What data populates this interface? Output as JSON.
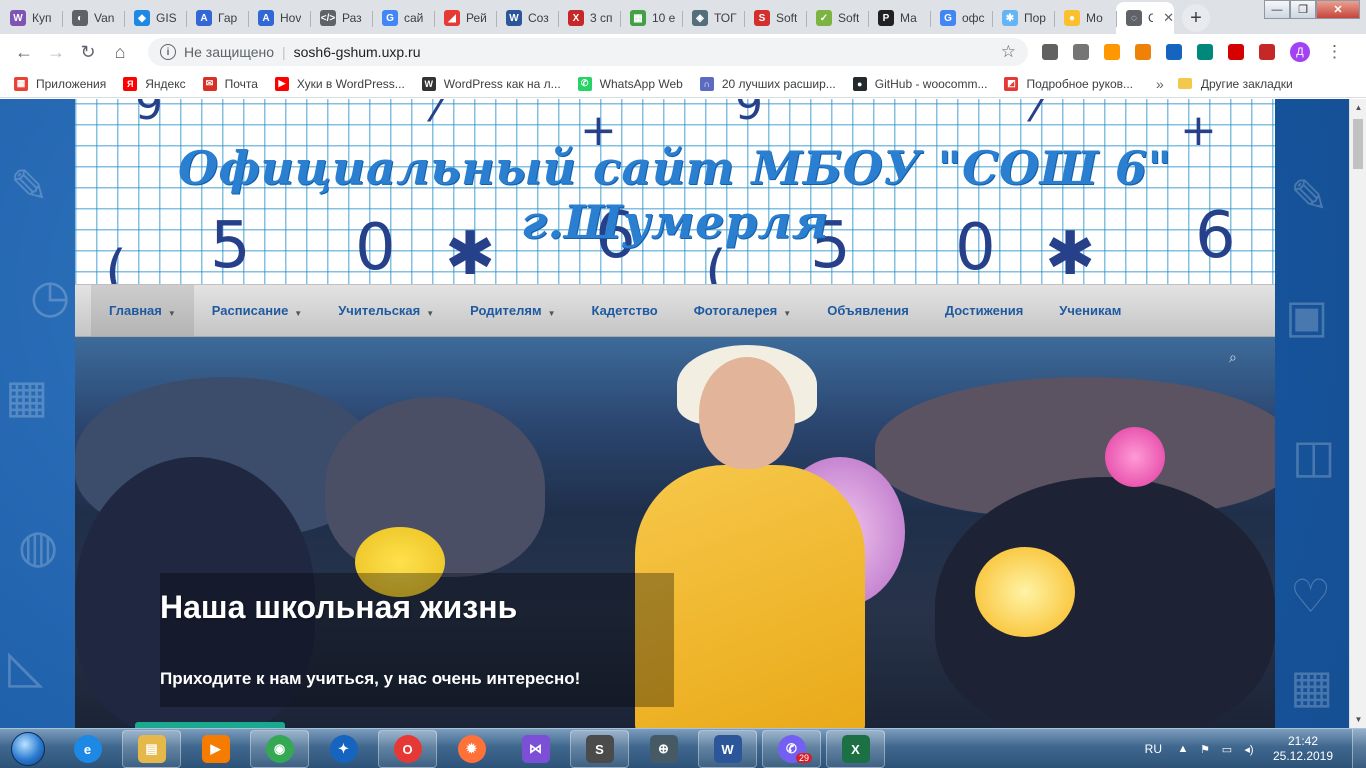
{
  "tabs": [
    {
      "title": "Куп",
      "icon": "woocommerce-icon",
      "color": "#7f54b3",
      "glyph": "W"
    },
    {
      "title": "Van",
      "icon": "globe-icon",
      "color": "#5f6368",
      "glyph": "◐"
    },
    {
      "title": "GIS",
      "icon": "drop-icon",
      "color": "#1e88e5",
      "glyph": "◆"
    },
    {
      "title": "Гар",
      "icon": "a-letter-icon",
      "color": "#3367d6",
      "glyph": "A"
    },
    {
      "title": "Hov",
      "icon": "a-letter-icon",
      "color": "#3367d6",
      "glyph": "A"
    },
    {
      "title": "Раз",
      "icon": "code-icon",
      "color": "#5f6368",
      "glyph": "</>"
    },
    {
      "title": "сай",
      "icon": "google-icon",
      "color": "#4285f4",
      "glyph": "G"
    },
    {
      "title": "Рей",
      "icon": "eraser-icon",
      "color": "#e53935",
      "glyph": "◢"
    },
    {
      "title": "Соз",
      "icon": "word-icon",
      "color": "#2b579a",
      "glyph": "W"
    },
    {
      "title": "3 сп",
      "icon": "x-tab-icon",
      "color": "#c62828",
      "glyph": "X"
    },
    {
      "title": "10 е",
      "icon": "grid-icon",
      "color": "#43a047",
      "glyph": "▦"
    },
    {
      "title": "ТОГ",
      "icon": "shield-icon",
      "color": "#546e7a",
      "glyph": "◈"
    },
    {
      "title": "Soft",
      "icon": "s-logo-icon",
      "color": "#d32f2f",
      "glyph": "S"
    },
    {
      "title": "Soft",
      "icon": "check-box-icon",
      "color": "#7cb342",
      "glyph": "✓"
    },
    {
      "title": "Ма",
      "icon": "p-circle-icon",
      "color": "#212121",
      "glyph": "P"
    },
    {
      "title": "офс",
      "icon": "google-icon",
      "color": "#4285f4",
      "glyph": "G"
    },
    {
      "title": "Пор",
      "icon": "snowflake-icon",
      "color": "#64b5f6",
      "glyph": "✱"
    },
    {
      "title": "Мо",
      "icon": "beeline-icon",
      "color": "#fbc02d",
      "glyph": "●"
    }
  ],
  "active_tab": {
    "title": "С",
    "close": "✕",
    "icon": "wordpress-icon"
  },
  "new_tab": "+",
  "window_controls": {
    "minimize": "—",
    "maximize": "❐",
    "close": "✕"
  },
  "address_bar": {
    "security_label": "Не защищено",
    "separator": "|",
    "url": "sosh6-gshum.uxp.ru",
    "info_glyph": "i",
    "star_glyph": "☆"
  },
  "nav_buttons": {
    "back": "←",
    "forward": "→",
    "reload": "↻",
    "home": "⌂"
  },
  "extensions": [
    {
      "name": "clock-ext-icon",
      "color": "#616161"
    },
    {
      "name": "puzzle-ext-icon",
      "color": "#757575"
    },
    {
      "name": "play-ext-icon",
      "color": "#ff9800"
    },
    {
      "name": "ok-ext-icon",
      "color": "#ee8208"
    },
    {
      "name": "globe-ext-icon",
      "color": "#1565c0"
    },
    {
      "name": "bookmark-ext-icon",
      "color": "#00897b"
    },
    {
      "name": "stop-ext-icon",
      "color": "#d50000"
    },
    {
      "name": "adblock-ext-icon",
      "color": "#c62828"
    }
  ],
  "profile_initial": "Д",
  "menu_glyph": "⋮",
  "bookmarks": [
    {
      "label": "Приложения",
      "icon": "apps-grid-icon",
      "color": "#ea4335",
      "glyph": "▦"
    },
    {
      "label": "Яндекс",
      "icon": "yandex-icon",
      "color": "#ff0000",
      "glyph": "Я"
    },
    {
      "label": "Почта",
      "icon": "mail-icon",
      "color": "#d93025",
      "glyph": "✉"
    },
    {
      "label": "Хуки в WordPress...",
      "icon": "youtube-icon",
      "color": "#ff0000",
      "glyph": "▶"
    },
    {
      "label": "WordPress как на л...",
      "icon": "wp-pen-icon",
      "color": "#333333",
      "glyph": "W"
    },
    {
      "label": "WhatsApp Web",
      "icon": "whatsapp-icon",
      "color": "#25d366",
      "glyph": "✆"
    },
    {
      "label": "20 лучших расшир...",
      "icon": "magnet-icon",
      "color": "#5c6bc0",
      "glyph": "∩"
    },
    {
      "label": "GitHub - woocomm...",
      "icon": "github-icon",
      "color": "#24292e",
      "glyph": "●"
    },
    {
      "label": "Подробное руков...",
      "icon": "article-icon",
      "color": "#e53935",
      "glyph": "◩"
    }
  ],
  "bookmarks_more": "»",
  "other_bookmarks": "Другие закладки",
  "site": {
    "title": "Официальный сайт МБОУ \"СОШ 6\" г.Шумерля",
    "nav": [
      {
        "label": "Главная",
        "dropdown": true,
        "current": true
      },
      {
        "label": "Расписание",
        "dropdown": true
      },
      {
        "label": "Учительская",
        "dropdown": true
      },
      {
        "label": "Родителям",
        "dropdown": true
      },
      {
        "label": "Кадетство",
        "dropdown": false
      },
      {
        "label": "Фотогалерея",
        "dropdown": true
      },
      {
        "label": "Объявления",
        "dropdown": false
      },
      {
        "label": "Достижения",
        "dropdown": false
      },
      {
        "label": "Ученикам",
        "dropdown": false
      }
    ],
    "caret": "▼",
    "slide": {
      "title": "Наша школьная жизнь",
      "subtitle": "Приходите к нам учиться, у нас очень интересно!"
    },
    "accent": "#1aa88f"
  },
  "taskbar": {
    "apps": [
      {
        "name": "ie-app",
        "glyph": "e",
        "color": "#1e88e5",
        "round": true,
        "pinned": false
      },
      {
        "name": "explorer-app",
        "glyph": "▤",
        "color": "#e6b84a",
        "round": false,
        "pinned": true
      },
      {
        "name": "media-player-app",
        "glyph": "▶",
        "color": "#f57c00",
        "round": false,
        "pinned": false
      },
      {
        "name": "chrome-app",
        "glyph": "◉",
        "color": "#34a853",
        "round": true,
        "pinned": true
      },
      {
        "name": "firefox-dev-app",
        "glyph": "✦",
        "color": "#1565c0",
        "round": true,
        "pinned": false
      },
      {
        "name": "opera-app",
        "glyph": "O",
        "color": "#e53935",
        "round": true,
        "pinned": true
      },
      {
        "name": "firefox-app",
        "glyph": "✹",
        "color": "#ff7139",
        "round": true,
        "pinned": false
      },
      {
        "name": "visual-studio-app",
        "glyph": "⋈",
        "color": "#7b4fd6",
        "round": false,
        "pinned": false
      },
      {
        "name": "sublime-app",
        "glyph": "S",
        "color": "#4b4b4b",
        "round": false,
        "pinned": true
      },
      {
        "name": "vpn-lock-app",
        "glyph": "⊕",
        "color": "#455a64",
        "round": false,
        "pinned": false
      },
      {
        "name": "word-app",
        "glyph": "W",
        "color": "#2b579a",
        "round": false,
        "pinned": true
      },
      {
        "name": "viber-app",
        "glyph": "✆",
        "color": "#7360f2",
        "round": true,
        "pinned": true,
        "badge": "29"
      },
      {
        "name": "excel-app",
        "glyph": "X",
        "color": "#1d7044",
        "round": false,
        "pinned": true
      }
    ],
    "language": "RU",
    "time": "21:42",
    "date": "25.12.2019",
    "tray_icons": [
      "▲",
      "⚑",
      "▭",
      "◂)"
    ]
  }
}
